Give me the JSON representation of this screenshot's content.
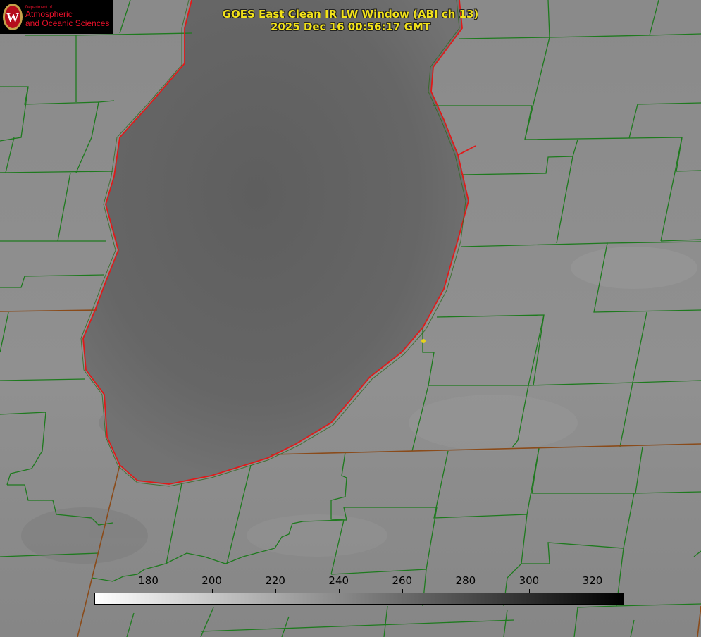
{
  "title": {
    "line1": "GOES East Clean IR LW Window (ABI ch 13)",
    "line2": "2025 Dec 16 00:56:17 GMT"
  },
  "logo": {
    "dept": "Department of",
    "line1": "Atmospheric",
    "line2": "and Oceanic Sciences",
    "crest_letter": "W"
  },
  "colorbar": {
    "min": 163,
    "max": 330,
    "ticks": [
      "180",
      "200",
      "220",
      "240",
      "260",
      "280",
      "300",
      "320"
    ],
    "tick_values": [
      180,
      200,
      220,
      240,
      260,
      280,
      300,
      320
    ]
  },
  "colors": {
    "county_border": "#1e7a1e",
    "shoreline": "#e01a1a",
    "state_border": "#8a4b1a",
    "title_text": "#f2e21a",
    "station_marker": "#e6d21a"
  }
}
